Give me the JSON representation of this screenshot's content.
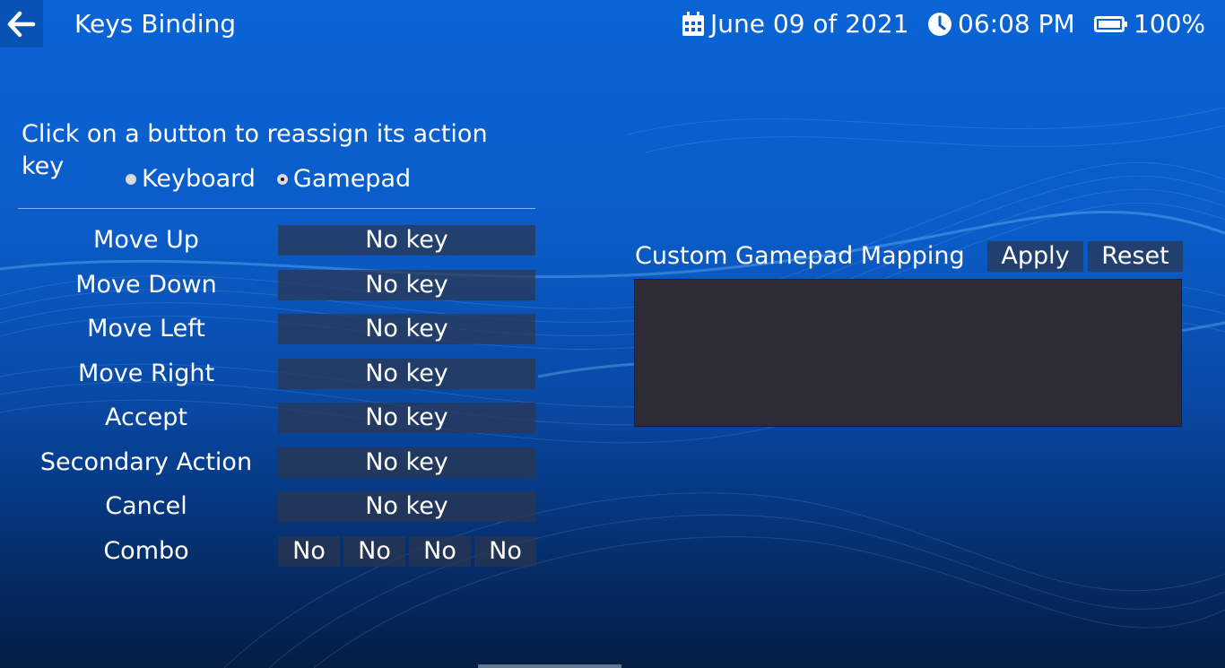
{
  "header": {
    "title": "Keys Binding",
    "date": "June 09 of 2021",
    "time": "06:08 PM",
    "battery": "100%"
  },
  "instructions": "Click on a button to reassign its action key",
  "input_mode": {
    "options": [
      "Keyboard",
      "Gamepad"
    ],
    "selected": "Gamepad"
  },
  "bindings": [
    {
      "action": "Move Up",
      "key": "No key"
    },
    {
      "action": "Move Down",
      "key": "No key"
    },
    {
      "action": "Move Left",
      "key": "No key"
    },
    {
      "action": "Move Right",
      "key": "No key"
    },
    {
      "action": "Accept",
      "key": "No key"
    },
    {
      "action": "Secondary Action",
      "key": "No key"
    },
    {
      "action": "Cancel",
      "key": "No key"
    }
  ],
  "combo": {
    "label": "Combo",
    "keys": [
      "No",
      "No",
      "No",
      "No"
    ]
  },
  "custom_mapping": {
    "title": "Custom Gamepad Mapping",
    "apply_label": "Apply",
    "reset_label": "Reset",
    "content": ""
  },
  "icons": {
    "back": "arrow-left-icon",
    "date": "calendar-icon",
    "time": "clock-icon",
    "battery": "battery-icon"
  }
}
